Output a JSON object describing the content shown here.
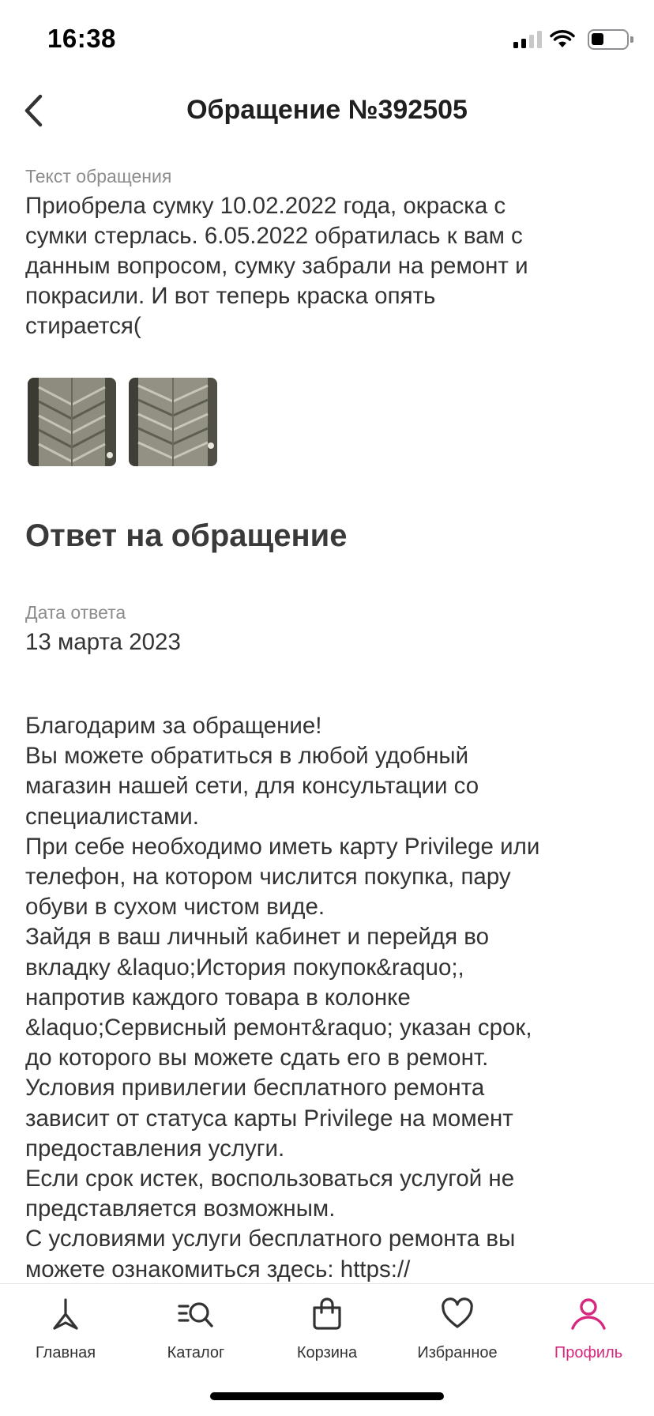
{
  "status_bar": {
    "time": "16:38"
  },
  "header": {
    "title": "Обращение №392505"
  },
  "appeal": {
    "label": "Текст обращения",
    "text": "Приобрела сумку 10.02.2022 года, окраска с\nсумки стерлась. 6.05.2022 обратилась к вам с\nданным вопросом, сумку забрали на ремонт и\nпокрасили. И вот теперь краска опять\nстирается("
  },
  "photos": [
    {
      "icon": "bag-photo-thumbnail"
    },
    {
      "icon": "bag-photo-thumbnail"
    }
  ],
  "answer": {
    "section_title": "Ответ на обращение",
    "date_label": "Дата ответа",
    "date_value": "13 марта 2023",
    "text": "Благодарим за обращение!\nВы можете обратиться в любой удобный\nмагазин нашей сети, для консультации со\nспециалистами.\nПри себе необходимо иметь карту Privilege или\nтелефон, на котором числится покупка, пару\nобуви в сухом чистом виде.\nЗайдя в ваш личный кабинет и перейдя во\nвкладку &laquo;История покупок&raquo;,\nнапротив каждого товара в колонке\n&laquo;Сервисный ремонт&raquo; указан срок,\nдо которого вы можете сдать его в ремонт.\nУсловия привилегии бесплатного ремонта\nзависит от статуса карты Privilege на момент\nпредоставления услуги.\nЕсли срок истек, воспользоваться услугой не\nпредставляется возможным.\nС условиями услуги бесплатного ремонта вы\nможете ознакомиться здесь: https://"
  },
  "tab_bar": {
    "tabs": [
      {
        "label": "Главная",
        "icon": "home-logo-icon",
        "active": false
      },
      {
        "label": "Каталог",
        "icon": "catalog-search-icon",
        "active": false
      },
      {
        "label": "Корзина",
        "icon": "bag-icon",
        "active": false
      },
      {
        "label": "Избранное",
        "icon": "heart-icon",
        "active": false
      },
      {
        "label": "Профиль",
        "icon": "profile-icon",
        "active": true
      }
    ]
  },
  "colors": {
    "accent": "#d6287e",
    "text": "#333333",
    "label": "#8c8c8c"
  }
}
